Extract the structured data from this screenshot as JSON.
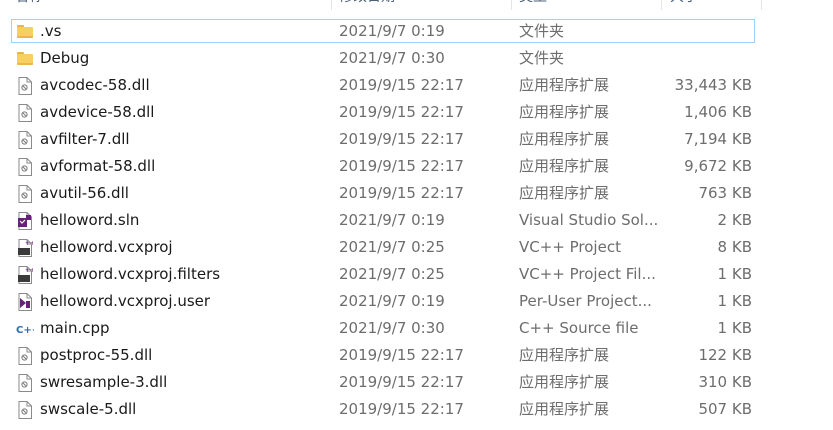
{
  "header": {
    "name": "名称",
    "date": "修改日期",
    "type": "类型",
    "size": "大小"
  },
  "files": [
    {
      "name": ".vs",
      "date": "2021/9/7 0:19",
      "type": "文件夹",
      "size": "",
      "icon": "folder-icon"
    },
    {
      "name": "Debug",
      "date": "2021/9/7 0:30",
      "type": "文件夹",
      "size": "",
      "icon": "folder-icon"
    },
    {
      "name": "avcodec-58.dll",
      "date": "2019/9/15 22:17",
      "type": "应用程序扩展",
      "size": "33,443 KB",
      "icon": "dll-file-icon"
    },
    {
      "name": "avdevice-58.dll",
      "date": "2019/9/15 22:17",
      "type": "应用程序扩展",
      "size": "1,406 KB",
      "icon": "dll-file-icon"
    },
    {
      "name": "avfilter-7.dll",
      "date": "2019/9/15 22:17",
      "type": "应用程序扩展",
      "size": "7,194 KB",
      "icon": "dll-file-icon"
    },
    {
      "name": "avformat-58.dll",
      "date": "2019/9/15 22:17",
      "type": "应用程序扩展",
      "size": "9,672 KB",
      "icon": "dll-file-icon"
    },
    {
      "name": "avutil-56.dll",
      "date": "2019/9/15 22:17",
      "type": "应用程序扩展",
      "size": "763 KB",
      "icon": "dll-file-icon"
    },
    {
      "name": "helloword.sln",
      "date": "2021/9/7 0:19",
      "type": "Visual Studio Sol...",
      "size": "2 KB",
      "icon": "visual-studio-solution-icon"
    },
    {
      "name": "helloword.vcxproj",
      "date": "2021/9/7 0:25",
      "type": "VC++ Project",
      "size": "8 KB",
      "icon": "vcxproj-file-icon"
    },
    {
      "name": "helloword.vcxproj.filters",
      "date": "2021/9/7 0:25",
      "type": "VC++ Project Fil...",
      "size": "1 KB",
      "icon": "vcxproj-filters-file-icon"
    },
    {
      "name": "helloword.vcxproj.user",
      "date": "2021/9/7 0:19",
      "type": "Per-User Project...",
      "size": "1 KB",
      "icon": "vcxproj-user-file-icon"
    },
    {
      "name": "main.cpp",
      "date": "2021/9/7 0:30",
      "type": "C++ Source file",
      "size": "1 KB",
      "icon": "cpp-file-icon"
    },
    {
      "name": "postproc-55.dll",
      "date": "2019/9/15 22:17",
      "type": "应用程序扩展",
      "size": "122 KB",
      "icon": "dll-file-icon"
    },
    {
      "name": "swresample-3.dll",
      "date": "2019/9/15 22:17",
      "type": "应用程序扩展",
      "size": "310 KB",
      "icon": "dll-file-icon"
    },
    {
      "name": "swscale-5.dll",
      "date": "2019/9/15 22:17",
      "type": "应用程序扩展",
      "size": "507 KB",
      "icon": "dll-file-icon"
    }
  ],
  "selected_index": 0,
  "colors": {
    "selection_border": "#99d1ff",
    "folder": "#f8cf62",
    "vs_purple": "#68217a",
    "cpp_blue": "#2b6cb6"
  }
}
